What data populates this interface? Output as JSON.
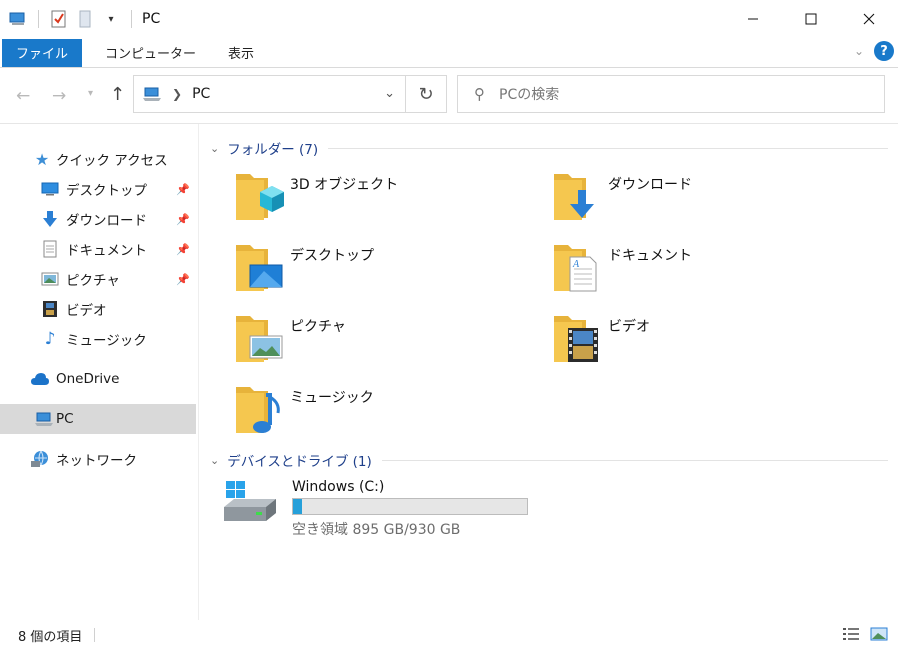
{
  "window": {
    "title": "PC"
  },
  "ribbon": {
    "tabs": [
      "ファイル",
      "コンピューター",
      "表示"
    ]
  },
  "address": {
    "crumb": "PC"
  },
  "search": {
    "placeholder": "PCの検索"
  },
  "sidebar": {
    "quick_access": "クイック アクセス",
    "items": [
      "デスクトップ",
      "ダウンロード",
      "ドキュメント",
      "ピクチャ",
      "ビデオ",
      "ミュージック"
    ],
    "onedrive": "OneDrive",
    "pc": "PC",
    "network": "ネットワーク"
  },
  "content": {
    "folders_header": "フォルダー (7)",
    "folders": [
      "3D オブジェクト",
      "ダウンロード",
      "デスクトップ",
      "ドキュメント",
      "ピクチャ",
      "ビデオ",
      "ミュージック"
    ],
    "drives_header": "デバイスとドライブ (1)",
    "drive": {
      "name": "Windows (C:)",
      "free_text": "空き領域 895 GB/930 GB",
      "used_fraction": 0.038
    }
  },
  "status": {
    "item_count": "8 個の項目"
  },
  "colors": {
    "accent": "#1979ca",
    "folder": "#f5c74f",
    "folder_dark": "#e7b33b",
    "link": "#1e3f8a"
  }
}
